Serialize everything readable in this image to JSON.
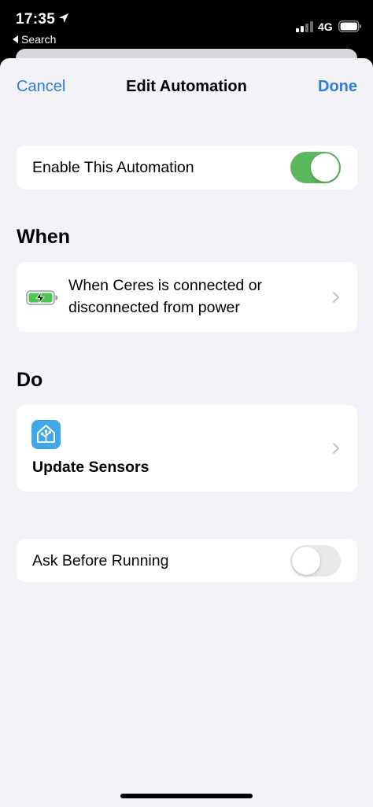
{
  "status_bar": {
    "time": "17:35",
    "back_app": "Search",
    "network": "4G",
    "icons": [
      "location-arrow-icon",
      "signal-bars-icon",
      "battery-icon"
    ]
  },
  "nav": {
    "cancel_label": "Cancel",
    "title": "Edit Automation",
    "done_label": "Done",
    "accent_color": "#2f7bdc"
  },
  "enable_row": {
    "label": "Enable This Automation",
    "enabled": true,
    "toggle_color": "#5cb85c"
  },
  "when_section": {
    "header": "When",
    "trigger_line1": "When Ceres is connected or",
    "trigger_line2": "disconnected from power",
    "icon": "battery-charging-icon"
  },
  "do_section": {
    "header": "Do",
    "action_label": "Update Sensors",
    "icon": "home-assistant-icon",
    "icon_color": "#41a8e8"
  },
  "ask_row": {
    "label": "Ask Before Running",
    "enabled": false
  }
}
